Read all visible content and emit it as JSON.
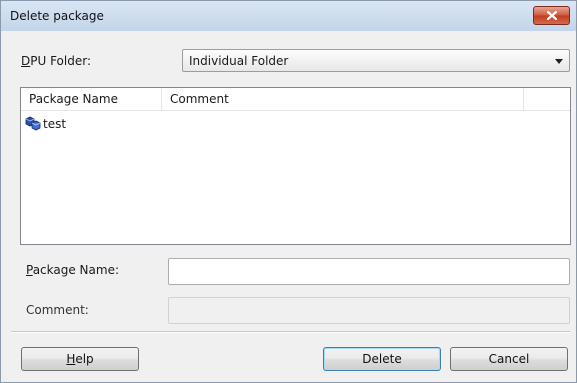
{
  "window": {
    "title": "Delete package"
  },
  "dpu_folder": {
    "label_mnemonic": "D",
    "label_rest": "PU Folder:",
    "selected": "Individual Folder"
  },
  "list": {
    "columns": [
      "Package Name",
      "Comment"
    ],
    "rows": [
      {
        "name": "test",
        "comment": "",
        "icon": "package-icon"
      }
    ]
  },
  "package_name": {
    "label_mnemonic": "P",
    "label_rest": "ackage Name:",
    "value": ""
  },
  "comment": {
    "label": "Comment:",
    "value": ""
  },
  "buttons": {
    "help_mnemonic": "H",
    "help_rest": "elp",
    "delete": "Delete",
    "cancel": "Cancel"
  },
  "colors": {
    "close_button": "#c13c1e",
    "titlebar": "#c3d5ea",
    "default_button_border": "#3c7fb1"
  }
}
